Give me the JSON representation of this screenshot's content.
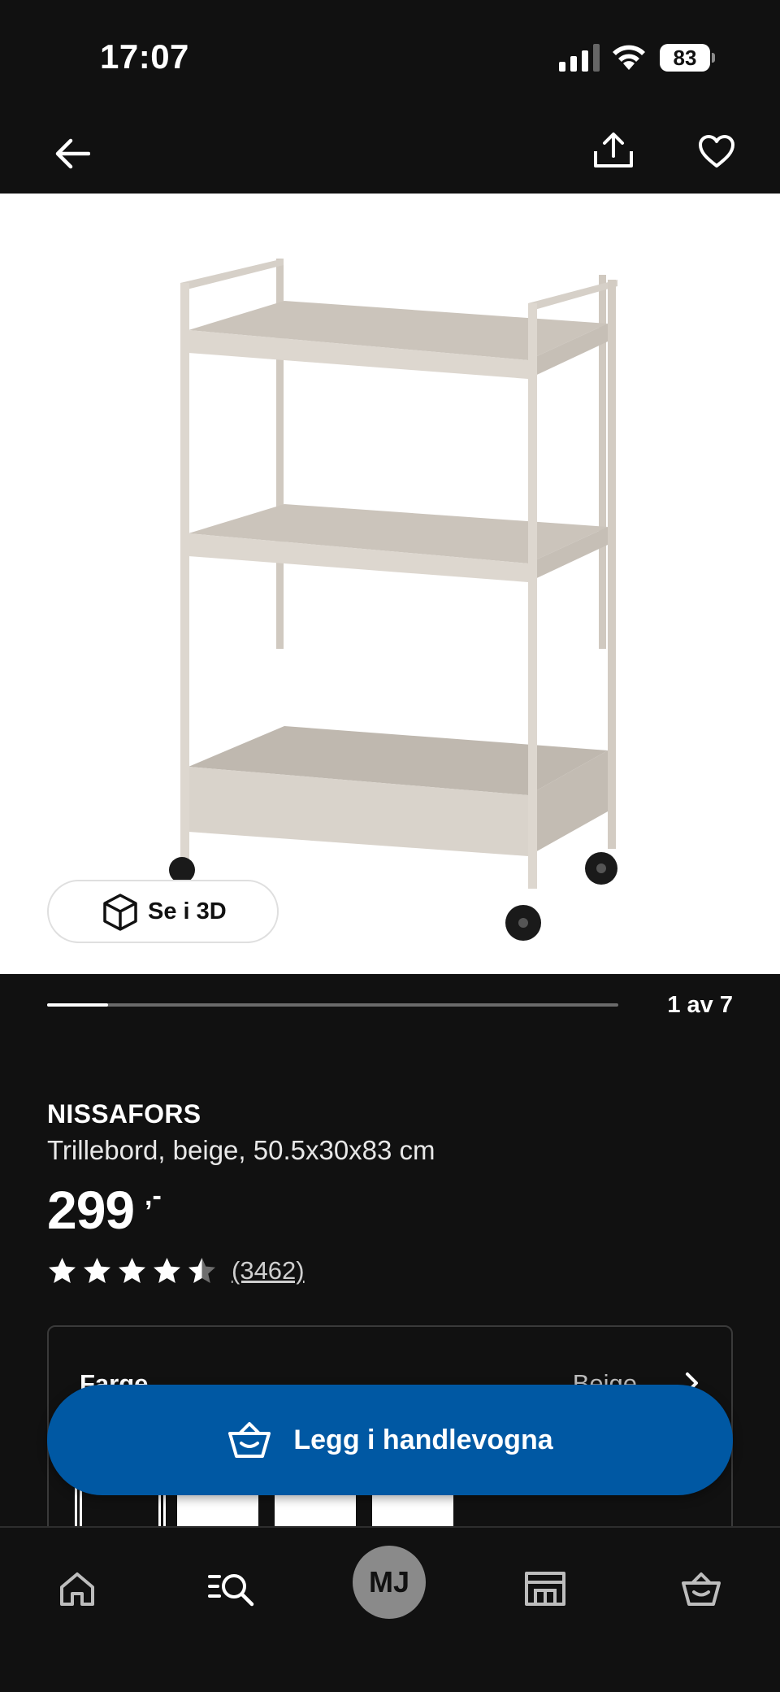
{
  "status_bar": {
    "time": "17:07",
    "battery": "83"
  },
  "top_nav": {
    "back_icon": "arrow-left-icon",
    "share_icon": "share-icon",
    "favorite_icon": "heart-icon"
  },
  "product_image": {
    "view_3d_label": "Se i 3D",
    "cube_icon": "cube-icon"
  },
  "pager": {
    "count_label": "1 av 7",
    "progress": 0.107
  },
  "product": {
    "name": "NISSAFORS",
    "description": "Trillebord, beige, 50.5x30x83 cm",
    "price": "299",
    "price_suffix": ",-",
    "rating": 4.5,
    "review_count": "(3462)"
  },
  "options": {
    "label": "Farge",
    "value": "Beige"
  },
  "actions": {
    "add_to_cart_label": "Legg i handlevogna"
  },
  "tab_bar": {
    "items": [
      {
        "icon": "home-icon"
      },
      {
        "icon": "search-list-icon"
      },
      {
        "icon": "avatar",
        "initials": "MJ"
      },
      {
        "icon": "store-icon"
      },
      {
        "icon": "cart-icon"
      }
    ]
  },
  "colors": {
    "background": "#111111",
    "accent_blue": "#0058a3",
    "product_beige": "#d6d0c8"
  }
}
